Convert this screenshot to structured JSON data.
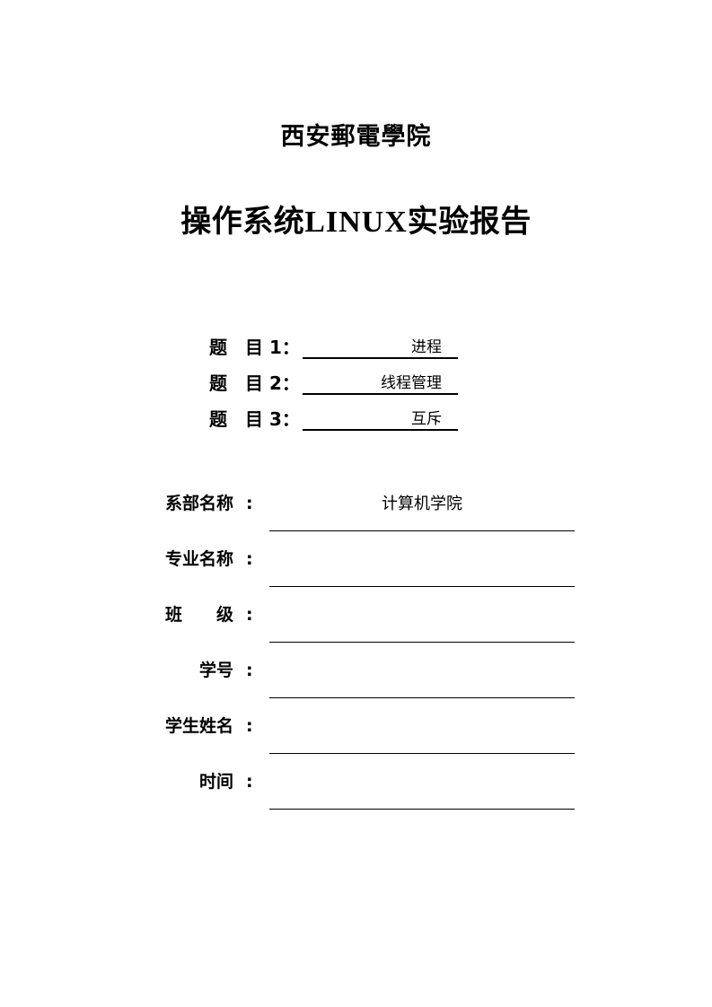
{
  "document": {
    "school_name": "西安郵電學院",
    "report_title_cn_prefix": "操作系统",
    "report_title_latin": "LINUX",
    "report_title_cn_suffix": "实验报告"
  },
  "topics": [
    {
      "label": "题　目 1：",
      "value": "进程"
    },
    {
      "label": "题　目 2：",
      "value": "线程管理"
    },
    {
      "label": "题　目 3：",
      "value": "互斥"
    }
  ],
  "info_rows": [
    {
      "label": "系部名称",
      "colon": ":",
      "value": "计算机学院"
    },
    {
      "label": "专业名称",
      "colon": ":",
      "value": ""
    },
    {
      "label": "班　　级",
      "colon": ":",
      "value": ""
    },
    {
      "label": "学号",
      "colon": ":",
      "value": ""
    },
    {
      "label": "学生姓名",
      "colon": ":",
      "value": ""
    },
    {
      "label": "时间",
      "colon": ":",
      "value": ""
    }
  ],
  "colors": {
    "text": "#000000",
    "page_background": "#ffffff",
    "rule": "#000000"
  }
}
